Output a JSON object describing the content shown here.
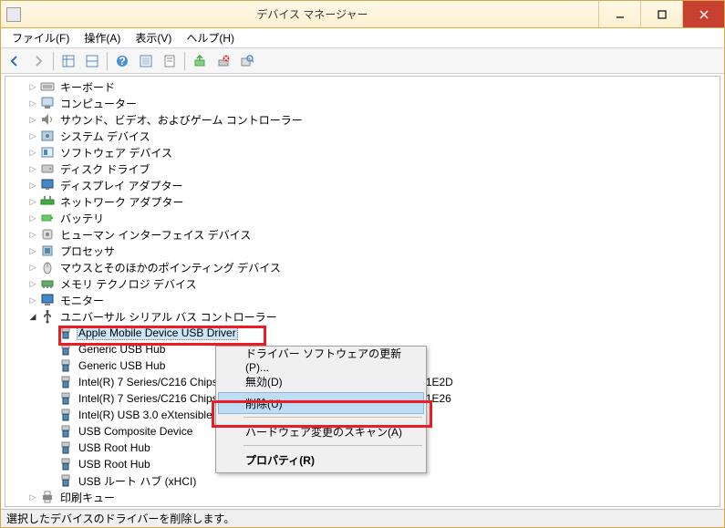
{
  "window": {
    "title": "デバイス マネージャー"
  },
  "menubar": {
    "file": "ファイル(F)",
    "action": "操作(A)",
    "view": "表示(V)",
    "help": "ヘルプ(H)"
  },
  "tree": {
    "categories": [
      {
        "label": "キーボード",
        "icon": "keyboard"
      },
      {
        "label": "コンピューター",
        "icon": "computer"
      },
      {
        "label": "サウンド、ビデオ、およびゲーム コントローラー",
        "icon": "sound"
      },
      {
        "label": "システム デバイス",
        "icon": "system"
      },
      {
        "label": "ソフトウェア デバイス",
        "icon": "software"
      },
      {
        "label": "ディスク ドライブ",
        "icon": "disk"
      },
      {
        "label": "ディスプレイ アダプター",
        "icon": "display"
      },
      {
        "label": "ネットワーク アダプター",
        "icon": "network"
      },
      {
        "label": "バッテリ",
        "icon": "battery"
      },
      {
        "label": "ヒューマン インターフェイス デバイス",
        "icon": "hid"
      },
      {
        "label": "プロセッサ",
        "icon": "cpu"
      },
      {
        "label": "マウスとそのほかのポインティング デバイス",
        "icon": "mouse"
      },
      {
        "label": "メモリ テクノロジ デバイス",
        "icon": "memory"
      },
      {
        "label": "モニター",
        "icon": "monitor"
      }
    ],
    "usb_category": "ユニバーサル シリアル バス コントローラー",
    "usb_children": [
      {
        "label": "Apple Mobile Device USB Driver",
        "selected": true
      },
      {
        "label": "Generic USB Hub"
      },
      {
        "label": "Generic USB Hub"
      },
      {
        "label": "Intel(R) 7 Series/C216 Chipset Family USB Enhanced Host Controller - 1E2D"
      },
      {
        "label": "Intel(R) 7 Series/C216 Chipset Family USB Enhanced Host Controller - 1E26"
      },
      {
        "label": "Intel(R) USB 3.0 eXtensible Host Controller"
      },
      {
        "label": "USB Composite Device"
      },
      {
        "label": "USB Root Hub"
      },
      {
        "label": "USB Root Hub"
      },
      {
        "label": "USB ルート ハブ (xHCI)"
      }
    ],
    "print_queue": "印刷キュー"
  },
  "contextmenu": {
    "update_driver": "ドライバー ソフトウェアの更新(P)...",
    "disable": "無効(D)",
    "uninstall": "削除(U)",
    "scan": "ハードウェア変更のスキャン(A)",
    "properties": "プロパティ(R)"
  },
  "statusbar": {
    "text": "選択したデバイスのドライバーを削除します。"
  }
}
